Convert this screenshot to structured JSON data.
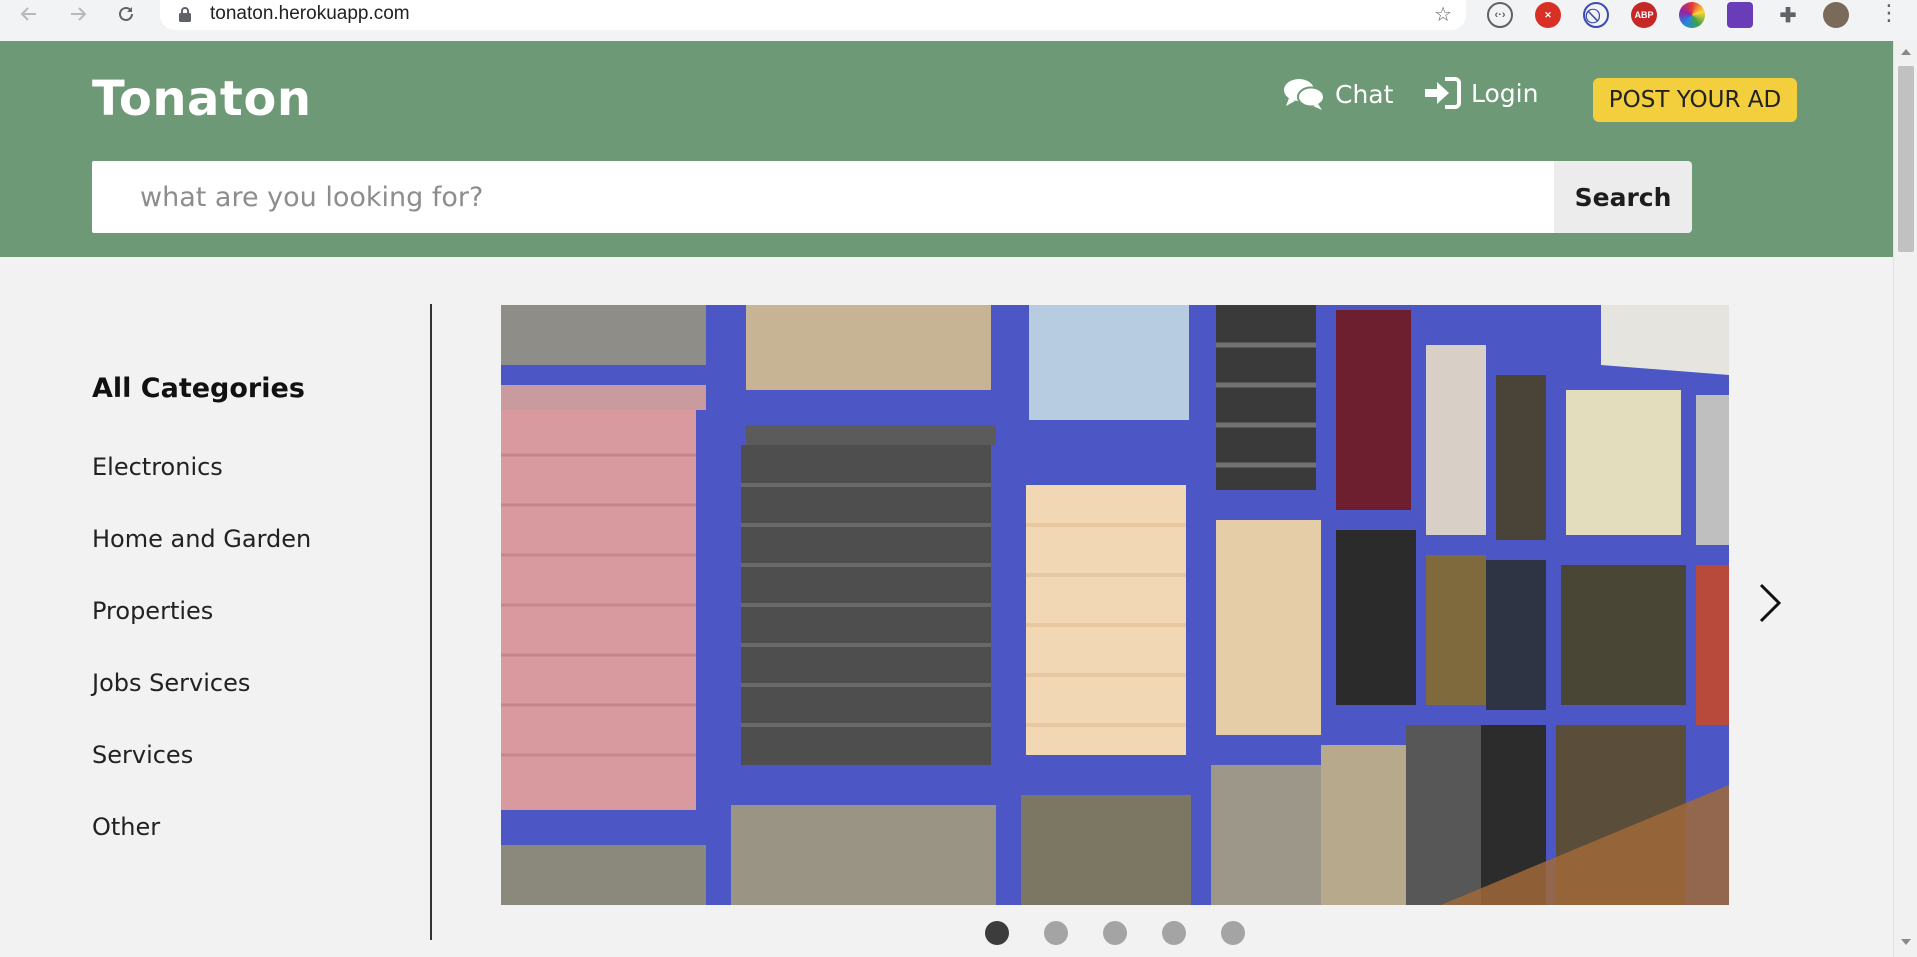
{
  "browser": {
    "url": "tonaton.herokuapp.com",
    "icons": {
      "back": "back-arrow-icon",
      "forward": "forward-arrow-icon",
      "reload": "reload-icon",
      "lock": "lock-icon",
      "bookmark": "star-icon"
    },
    "extensions": [
      {
        "name": "code-extension-icon",
        "color": "#5f6368"
      },
      {
        "name": "block-extension-icon",
        "color": "#d93025"
      },
      {
        "name": "no-sign-extension-icon",
        "color": "#3c4bb0"
      },
      {
        "name": "adblock-plus-extension-icon",
        "color": "#c62828",
        "text": "ABP"
      },
      {
        "name": "color-wheel-extension-icon",
        "color": "#f4b400"
      },
      {
        "name": "hat-extension-icon",
        "color": "#6a3db8"
      },
      {
        "name": "puzzle-extensions-icon",
        "color": "#5f6368"
      },
      {
        "name": "profile-avatar",
        "color": "#7a6a5a"
      }
    ]
  },
  "header": {
    "brand": "Tonaton",
    "chat_label": "Chat",
    "login_label": "Login",
    "post_ad_label": "POST YOUR AD",
    "colors": {
      "background": "#6e9977",
      "post_button": "#f3ce3d"
    }
  },
  "search": {
    "placeholder": "what are you looking for?",
    "value": "",
    "button_label": "Search"
  },
  "sidebar": {
    "title": "All Categories",
    "items": [
      {
        "label": "Electronics"
      },
      {
        "label": "Home and Garden"
      },
      {
        "label": "Properties"
      },
      {
        "label": "Jobs Services"
      },
      {
        "label": "Services"
      },
      {
        "label": "Other"
      }
    ]
  },
  "carousel": {
    "image_subject": "window blinds showroom",
    "slide_count": 5,
    "active_slide": 1,
    "next_icon": "chevron-right-icon"
  }
}
